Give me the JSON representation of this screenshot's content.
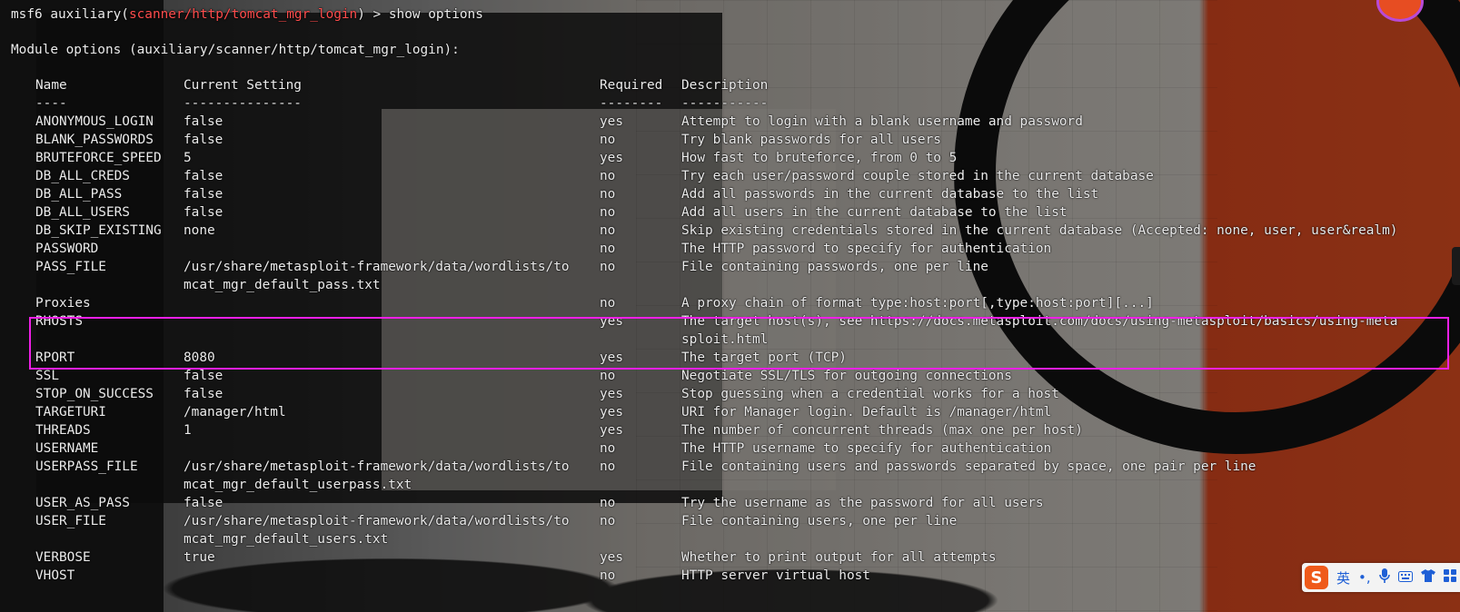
{
  "prompt": {
    "prefix": "msf6 auxiliary(",
    "module": "scanner/http/tomcat_mgr_login",
    "suffix": ") > ",
    "command": "show options"
  },
  "module_options_heading": "Module options (auxiliary/scanner/http/tomcat_mgr_login):",
  "table": {
    "headers": {
      "name": "Name",
      "setting": "Current Setting",
      "required": "Required",
      "description": "Description"
    },
    "underlines": {
      "name": "----",
      "setting": "---------------",
      "required": "--------",
      "description": "-----------"
    },
    "rows": [
      {
        "name": "ANONYMOUS_LOGIN",
        "setting": "false",
        "required": "yes",
        "description": "Attempt to login with a blank username and password"
      },
      {
        "name": "BLANK_PASSWORDS",
        "setting": "false",
        "required": "no",
        "description": "Try blank passwords for all users"
      },
      {
        "name": "BRUTEFORCE_SPEED",
        "setting": "5",
        "required": "yes",
        "description": "How fast to bruteforce, from 0 to 5"
      },
      {
        "name": "DB_ALL_CREDS",
        "setting": "false",
        "required": "no",
        "description": "Try each user/password couple stored in the current database"
      },
      {
        "name": "DB_ALL_PASS",
        "setting": "false",
        "required": "no",
        "description": "Add all passwords in the current database to the list"
      },
      {
        "name": "DB_ALL_USERS",
        "setting": "false",
        "required": "no",
        "description": "Add all users in the current database to the list"
      },
      {
        "name": "DB_SKIP_EXISTING",
        "setting": "none",
        "required": "no",
        "description": "Skip existing credentials stored in the current database (Accepted: none, user, user&realm)"
      },
      {
        "name": "PASSWORD",
        "setting": "",
        "required": "no",
        "description": "The HTTP password to specify for authentication"
      },
      {
        "name": "PASS_FILE",
        "setting": "/usr/share/metasploit-framework/data/wordlists/to",
        "required": "no",
        "description": "File containing passwords, one per line",
        "setting_cont": "mcat_mgr_default_pass.txt"
      },
      {
        "name": "Proxies",
        "setting": "",
        "required": "no",
        "description": "A proxy chain of format type:host:port[,type:host:port][...]"
      },
      {
        "name": "RHOSTS",
        "setting": "",
        "required": "yes",
        "description": "The target host(s), see https://docs.metasploit.com/docs/using-metasploit/basics/using-meta",
        "desc_cont": "sploit.html"
      },
      {
        "name": "RPORT",
        "setting": "8080",
        "required": "yes",
        "description": "The target port (TCP)"
      },
      {
        "name": "SSL",
        "setting": "false",
        "required": "no",
        "description": "Negotiate SSL/TLS for outgoing connections"
      },
      {
        "name": "STOP_ON_SUCCESS",
        "setting": "false",
        "required": "yes",
        "description": "Stop guessing when a credential works for a host"
      },
      {
        "name": "TARGETURI",
        "setting": "/manager/html",
        "required": "yes",
        "description": "URI for Manager login. Default is /manager/html"
      },
      {
        "name": "THREADS",
        "setting": "1",
        "required": "yes",
        "description": "The number of concurrent threads (max one per host)"
      },
      {
        "name": "USERNAME",
        "setting": "",
        "required": "no",
        "description": "The HTTP username to specify for authentication"
      },
      {
        "name": "USERPASS_FILE",
        "setting": "/usr/share/metasploit-framework/data/wordlists/to",
        "required": "no",
        "description": "File containing users and passwords separated by space, one pair per line",
        "setting_cont": "mcat_mgr_default_userpass.txt"
      },
      {
        "name": "USER_AS_PASS",
        "setting": "false",
        "required": "no",
        "description": "Try the username as the password for all users"
      },
      {
        "name": "USER_FILE",
        "setting": "/usr/share/metasploit-framework/data/wordlists/to",
        "required": "no",
        "description": "File containing users, one per line",
        "setting_cont": "mcat_mgr_default_users.txt"
      },
      {
        "name": "VERBOSE",
        "setting": "true",
        "required": "yes",
        "description": "Whether to print output for all attempts"
      },
      {
        "name": "VHOST",
        "setting": "",
        "required": "no",
        "description": "HTTP server virtual host"
      }
    ]
  },
  "highlight_color": "#ee1fe6",
  "module_color": "#ff4d4d",
  "ime_toolbar": {
    "logo": "S",
    "lang": "英",
    "punct": "•,",
    "icons": [
      "mic-icon",
      "keyboard-icon",
      "shirt-icon",
      "grid-icon"
    ]
  }
}
